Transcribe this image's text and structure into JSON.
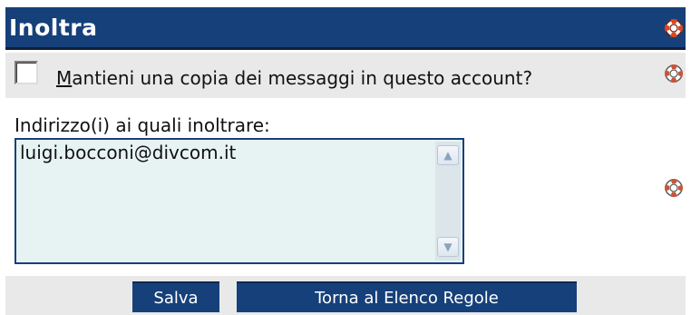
{
  "header": {
    "title": "Inoltra",
    "help_icon": "help-lifebuoy-icon"
  },
  "keep_copy": {
    "checked": false,
    "label_access_key": "M",
    "label_rest": "antieni una copia dei messaggi in questo account?",
    "help_icon": "help-lifebuoy-icon"
  },
  "forward_to": {
    "label": "Indirizzo(i) ai quali inoltrare:",
    "value": "luigi.bocconi@divcom.it",
    "help_icon": "help-lifebuoy-icon",
    "scroll_up_icon": "triangle-up-icon",
    "scroll_down_icon": "triangle-down-icon"
  },
  "buttons": {
    "save_label": "Salva",
    "back_label": "Torna al Elenco Regole"
  },
  "colors": {
    "header_bg": "#16407a",
    "button_bg": "#16407a",
    "textarea_bg": "#e7f3f3",
    "row_bg": "#e9e9e9"
  }
}
